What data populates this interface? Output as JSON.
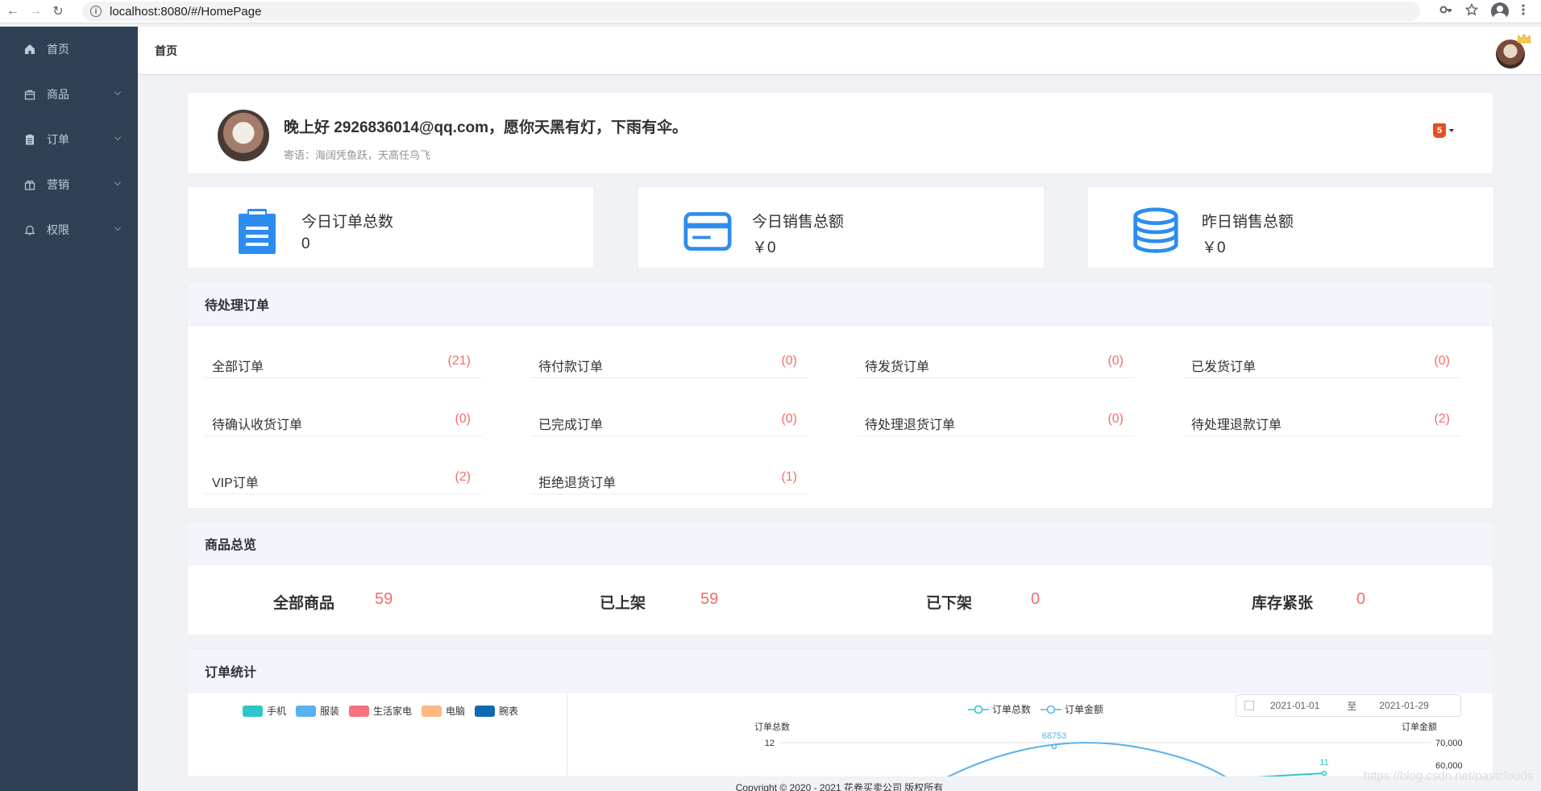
{
  "browser": {
    "url": "localhost:8080/#/HomePage"
  },
  "sidebar": {
    "items": [
      {
        "label": "首页",
        "icon": "home-icon",
        "has_arrow": false
      },
      {
        "label": "商品",
        "icon": "bag-icon",
        "has_arrow": true
      },
      {
        "label": "订单",
        "icon": "clipboard-icon",
        "has_arrow": true
      },
      {
        "label": "营销",
        "icon": "gift-icon",
        "has_arrow": true
      },
      {
        "label": "权限",
        "icon": "bell-icon",
        "has_arrow": true
      }
    ]
  },
  "header": {
    "breadcrumb": "首页"
  },
  "welcome": {
    "greeting": "晚上好 2926836014@qq.com，愿你天黑有灯，下雨有伞。",
    "motto": "寄语：海阔凭鱼跃，天高任鸟飞"
  },
  "stats": [
    {
      "title": "今日订单总数",
      "value": "0",
      "icon": "clipboard-icon"
    },
    {
      "title": "今日销售总额",
      "value": "￥0",
      "icon": "credit-card-icon"
    },
    {
      "title": "昨日销售总额",
      "value": "￥0",
      "icon": "database-icon"
    }
  ],
  "pending": {
    "title": "待处理订单",
    "items": [
      {
        "label": "全部订单",
        "count": "(21)"
      },
      {
        "label": "待付款订单",
        "count": "(0)"
      },
      {
        "label": "待发货订单",
        "count": "(0)"
      },
      {
        "label": "已发货订单",
        "count": "(0)"
      },
      {
        "label": "待确认收货订单",
        "count": "(0)"
      },
      {
        "label": "已完成订单",
        "count": "(0)"
      },
      {
        "label": "待处理退货订单",
        "count": "(0)"
      },
      {
        "label": "待处理退款订单",
        "count": "(2)"
      },
      {
        "label": "VIP订单",
        "count": "(2)"
      },
      {
        "label": "拒绝退货订单",
        "count": "(1)"
      }
    ]
  },
  "goods": {
    "title": "商品总览",
    "items": [
      {
        "label": "全部商品",
        "value": "59"
      },
      {
        "label": "已上架",
        "value": "59"
      },
      {
        "label": "已下架",
        "value": "0"
      },
      {
        "label": "库存紧张",
        "value": "0"
      }
    ]
  },
  "order_stats": {
    "title": "订单统计",
    "pie_legend": [
      {
        "name": "手机",
        "color": "#2ec7c9"
      },
      {
        "name": "服装",
        "color": "#5ab1ef"
      },
      {
        "name": "生活家电",
        "color": "#f5737f"
      },
      {
        "name": "电脑",
        "color": "#ffb980"
      },
      {
        "name": "腕表",
        "color": "#0e6bb0"
      }
    ],
    "line_legend": [
      {
        "name": "订单总数",
        "color": "#2ec7c9"
      },
      {
        "name": "订单金额",
        "color": "#5ab1ef"
      }
    ],
    "date_from": "2021-01-01",
    "date_sep": "至",
    "date_to": "2021-01-29"
  },
  "chart_data": {
    "type": "line",
    "ylabel_left": "订单总数",
    "ylabel_right": "订单金额",
    "y_left_visible_tick": "12",
    "y_right_visible_tick": "70,000",
    "y_right_partial_tick": "60,000",
    "series": [
      {
        "name": "订单金额",
        "peak_label": "68753"
      },
      {
        "name": "订单总数",
        "last_label": "11"
      }
    ]
  },
  "footer": {
    "copyright": "Copyright © 2020 - 2021 花卷买卖公司 版权所有",
    "watermark": "https://blog.csdn.net/pastclouds"
  }
}
